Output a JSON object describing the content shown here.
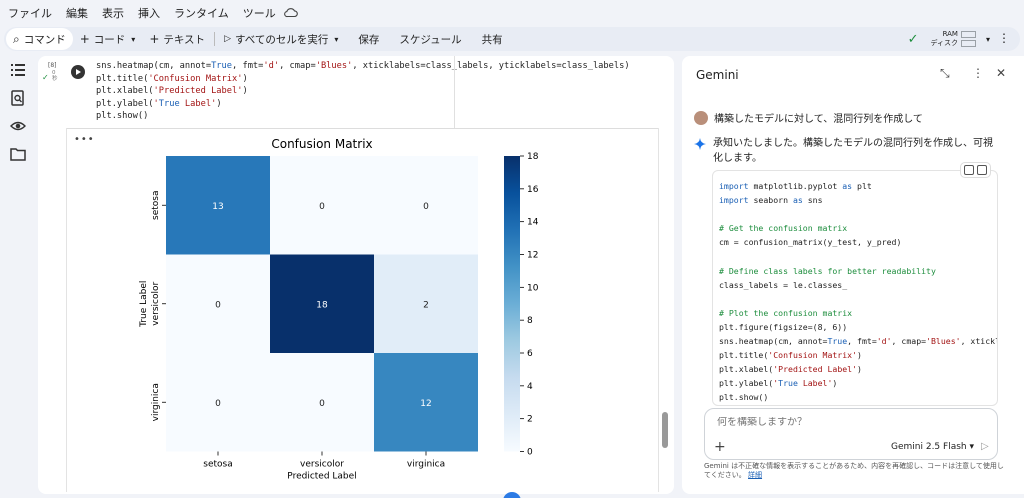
{
  "menu": [
    "ファイル",
    "編集",
    "表示",
    "挿入",
    "ランタイム",
    "ツール"
  ],
  "toolbar": {
    "command": "コマンド",
    "code": "コード",
    "text": "テキスト",
    "run_all": "すべてのセルを実行",
    "save": "保存",
    "schedule": "スケジュール",
    "share": "共有",
    "ram": "RAM",
    "disk": "ディスク"
  },
  "cell": {
    "exec_count": "[8]",
    "meta": [
      "0",
      "秒"
    ],
    "code": [
      "sns.heatmap(cm, annot=True, fmt='d', cmap='Blues', xticklabels=class_labels, yticklabels=class_labels)",
      "plt.title('Confusion Matrix')",
      "plt.xlabel('Predicted Label')",
      "plt.ylabel('True Label')",
      "plt.show()"
    ]
  },
  "chart_data": {
    "type": "heatmap",
    "title": "Confusion Matrix",
    "xlabel": "Predicted Label",
    "ylabel": "True Label",
    "categories": [
      "setosa",
      "versicolor",
      "virginica"
    ],
    "matrix": [
      [
        13,
        0,
        0
      ],
      [
        0,
        18,
        2
      ],
      [
        0,
        0,
        12
      ]
    ],
    "colorbar_ticks": [
      0,
      2,
      4,
      6,
      8,
      10,
      12,
      14,
      16,
      18
    ],
    "vmin": 0,
    "vmax": 18,
    "colormap": "Blues"
  },
  "gemini": {
    "title": "Gemini",
    "user_message": "構築したモデルに対して、混同行列を作成して",
    "ai_message": "承知いたしました。構築したモデルの混同行列を作成し、可視化します。",
    "code": [
      "import matplotlib.pyplot as plt",
      "import seaborn as sns",
      "",
      "# Get the confusion matrix",
      "cm = confusion_matrix(y_test, y_pred)",
      "",
      "# Define class labels for better readability",
      "class_labels = le.classes_",
      "",
      "# Plot the confusion matrix",
      "plt.figure(figsize=(8, 6))",
      "sns.heatmap(cm, annot=True, fmt='d', cmap='Blues', xticklabels=class_labels, yticklabels=class_labels)",
      "plt.title('Confusion Matrix')",
      "plt.xlabel('Predicted Label')",
      "plt.ylabel('True Label')",
      "plt.show()"
    ],
    "prompt_placeholder": "何を構築しますか？",
    "model": "Gemini 2.5 Flash",
    "disclaimer": "Gemini は不正確な情報を表示することがあるため、内容を再確認し、コードは注意して使用してください。",
    "disclaimer_link": "詳細"
  }
}
